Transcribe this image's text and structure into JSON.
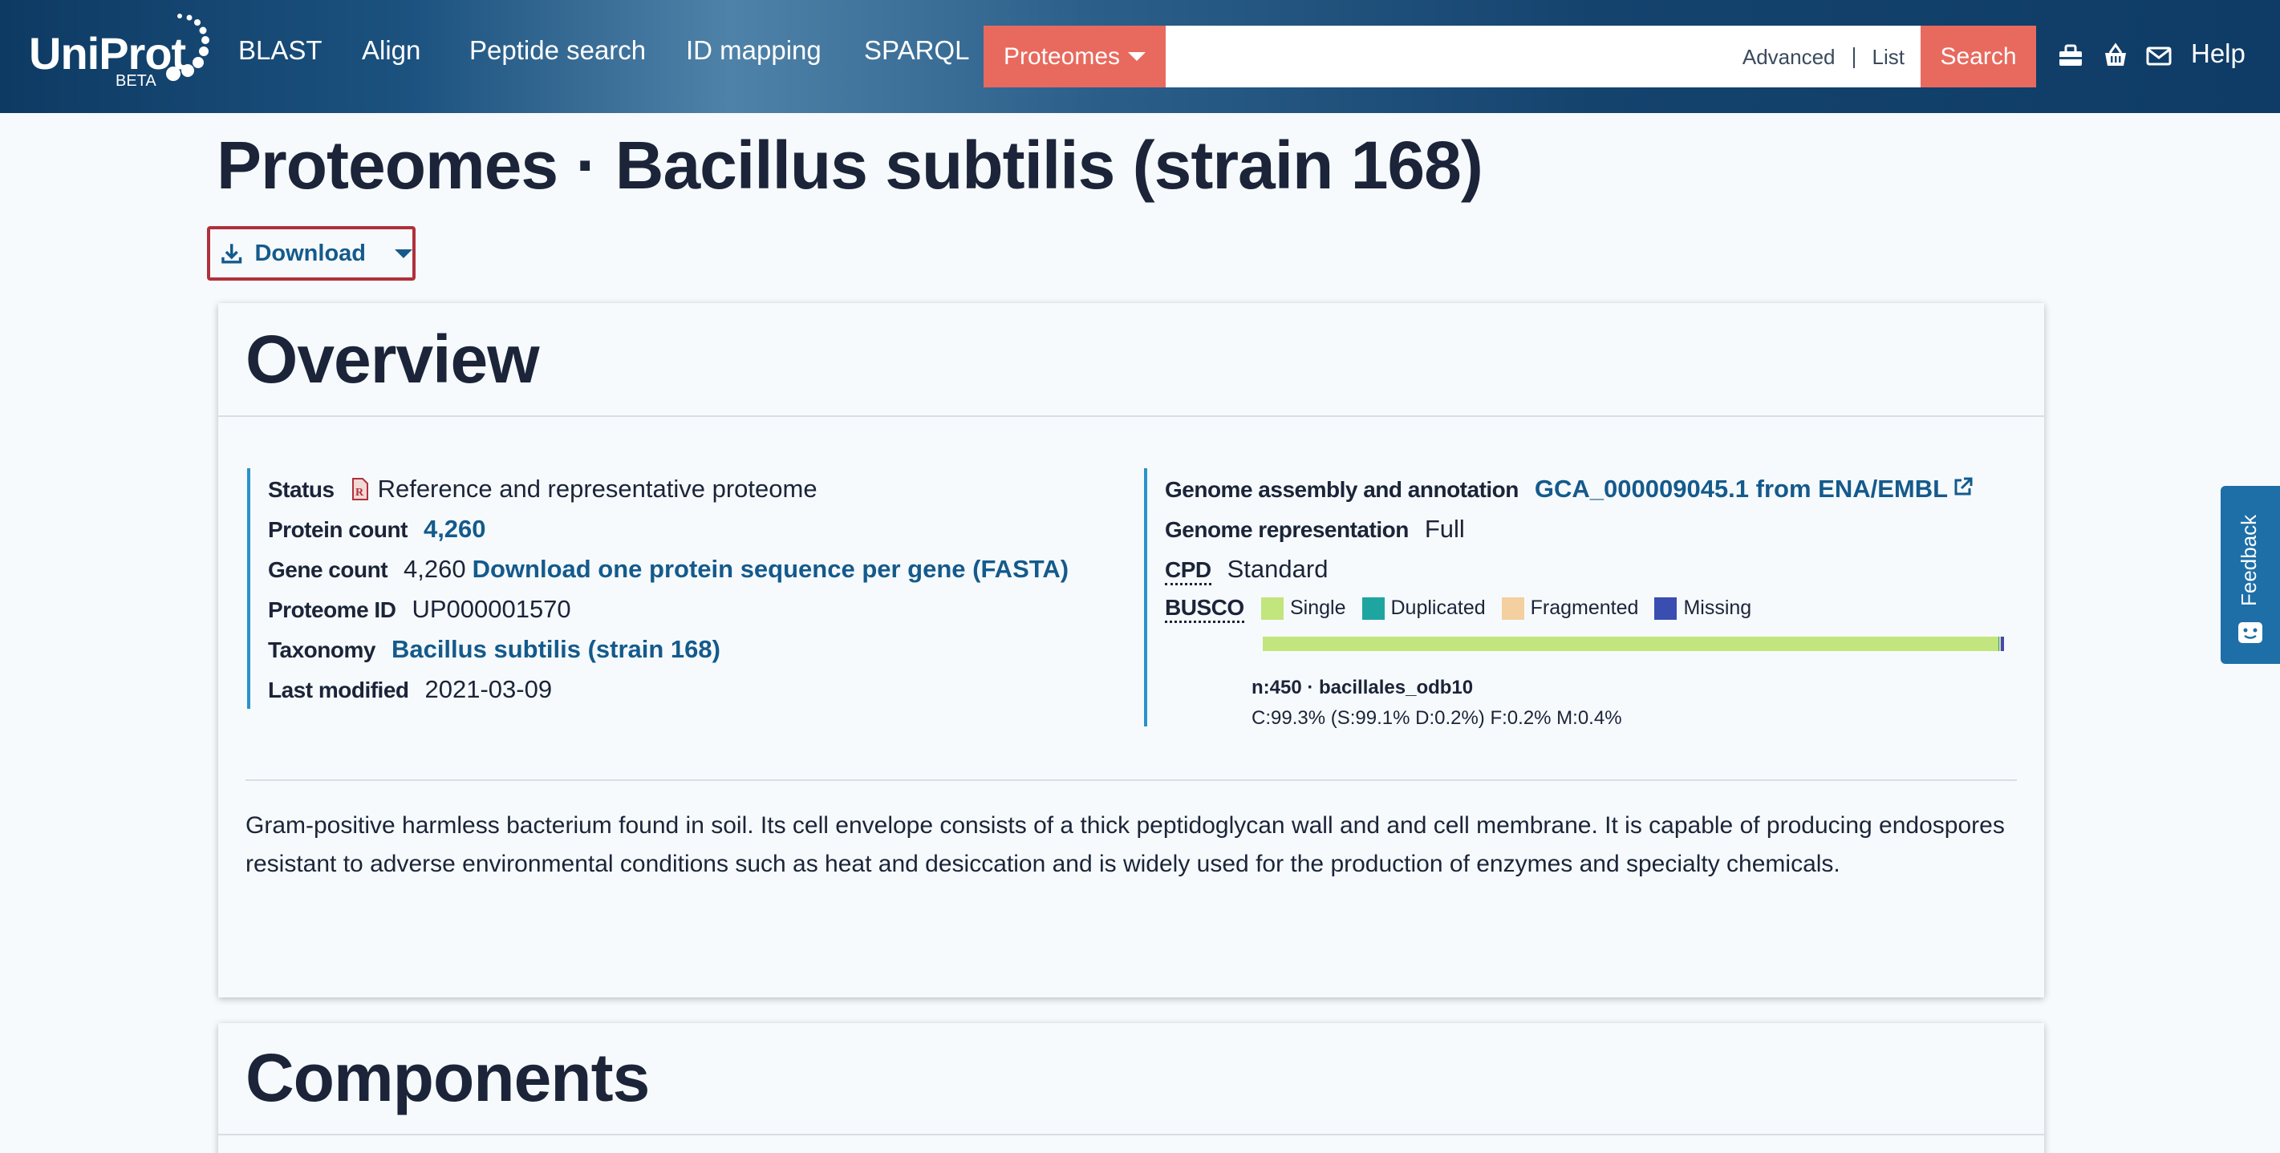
{
  "header": {
    "logo_text": "UniProt",
    "logo_beta": "BETA",
    "nav": [
      "BLAST",
      "Align",
      "Peptide search",
      "ID mapping",
      "SPARQL"
    ],
    "scope": "Proteomes",
    "search_value": "",
    "advanced": "Advanced",
    "list": "List",
    "search_button": "Search",
    "icons": [
      "toolbox-icon",
      "basket-icon",
      "mail-icon"
    ],
    "help": "Help"
  },
  "page": {
    "title": "Proteomes · Bacillus subtilis (strain 168)",
    "download_label": "Download"
  },
  "overview": {
    "title": "Overview",
    "left": {
      "status_label": "Status",
      "status_value": "Reference and representative proteome",
      "protein_count_label": "Protein count",
      "protein_count_value": "4,260",
      "gene_count_label": "Gene count",
      "gene_count_value": "4,260",
      "gene_count_link": "Download one protein sequence per gene (FASTA)",
      "proteome_id_label": "Proteome ID",
      "proteome_id_value": "UP000001570",
      "taxonomy_label": "Taxonomy",
      "taxonomy_value": "Bacillus subtilis (strain 168)",
      "last_modified_label": "Last modified",
      "last_modified_value": "2021-03-09"
    },
    "right": {
      "assembly_label": "Genome assembly and annotation",
      "assembly_value": "GCA_000009045.1 from ENA/EMBL",
      "representation_label": "Genome representation",
      "representation_value": "Full",
      "cpd_label": "CPD",
      "cpd_value": "Standard",
      "busco_label": "BUSCO",
      "busco_legend": [
        {
          "name": "Single",
          "color": "#c2e57e"
        },
        {
          "name": "Duplicated",
          "color": "#1fa5a0"
        },
        {
          "name": "Fragmented",
          "color": "#f4cfa0"
        },
        {
          "name": "Missing",
          "color": "#3a4db0"
        }
      ],
      "busco_percent": {
        "single": 99.1,
        "duplicated": 0.2,
        "fragmented": 0.2,
        "missing": 0.4
      },
      "busco_line1": "n:450 · bacillales_odb10",
      "busco_line2": "C:99.3% (S:99.1% D:0.2%) F:0.2% M:0.4%"
    },
    "description": "Gram-positive harmless bacterium found in soil. Its cell envelope consists of a thick peptidoglycan wall and and cell membrane. It is capable of producing endospores resistant to adverse environmental conditions such as heat and desiccation and is widely used for the production of enzymes and specialty chemicals."
  },
  "components": {
    "title": "Components"
  },
  "feedback": "Feedback",
  "colors": {
    "header_dark": "#0e3c66",
    "accent": "#e86a5e",
    "link": "#145a8c",
    "border_accent": "#2a93c9",
    "highlight_box": "#b0303b"
  }
}
